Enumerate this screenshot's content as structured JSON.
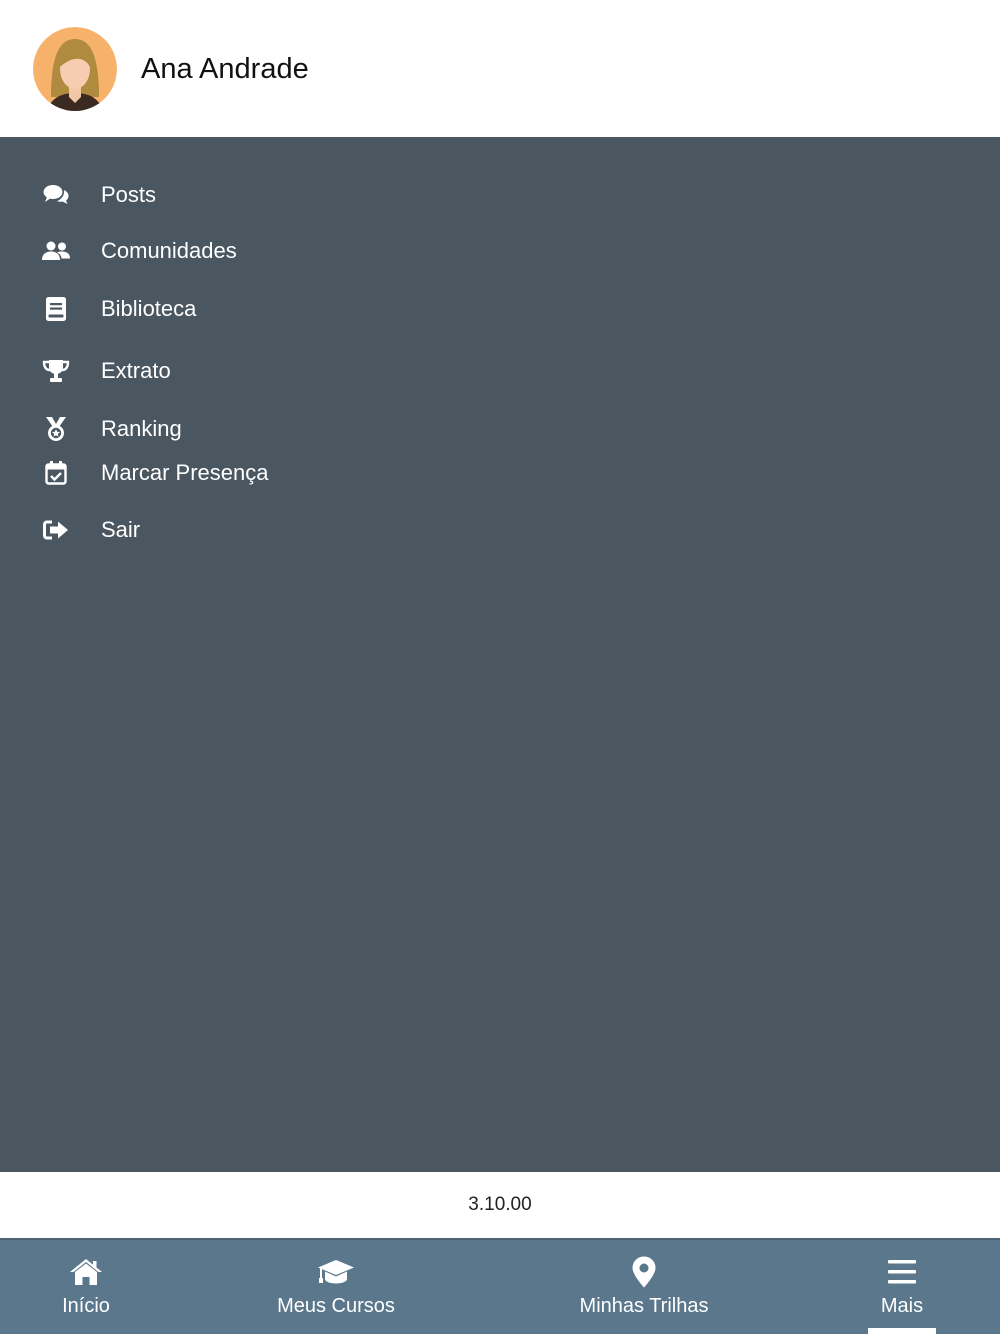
{
  "user": {
    "name": "Ana Andrade"
  },
  "menu": {
    "items": [
      {
        "label": "Posts",
        "icon": "comments-icon"
      },
      {
        "label": "Comunidades",
        "icon": "users-icon"
      },
      {
        "label": "Biblioteca",
        "icon": "book-icon"
      },
      {
        "label": "Extrato",
        "icon": "trophy-icon"
      },
      {
        "label": "Ranking",
        "icon": "medal-icon"
      },
      {
        "label": "Marcar Presença",
        "icon": "calendar-check-icon"
      },
      {
        "label": "Sair",
        "icon": "sign-out-icon"
      }
    ]
  },
  "app": {
    "version": "3.10.00"
  },
  "bottom_nav": {
    "items": [
      {
        "label": "Início",
        "icon": "home-icon"
      },
      {
        "label": "Meus Cursos",
        "icon": "graduation-cap-icon"
      },
      {
        "label": "Minhas Trilhas",
        "icon": "map-marker-icon"
      },
      {
        "label": "Mais",
        "icon": "menu-icon",
        "active": true
      }
    ]
  },
  "colors": {
    "menu_background": "#4a5660",
    "nav_background": "#5a778c",
    "avatar_background": "#f6b26b"
  }
}
